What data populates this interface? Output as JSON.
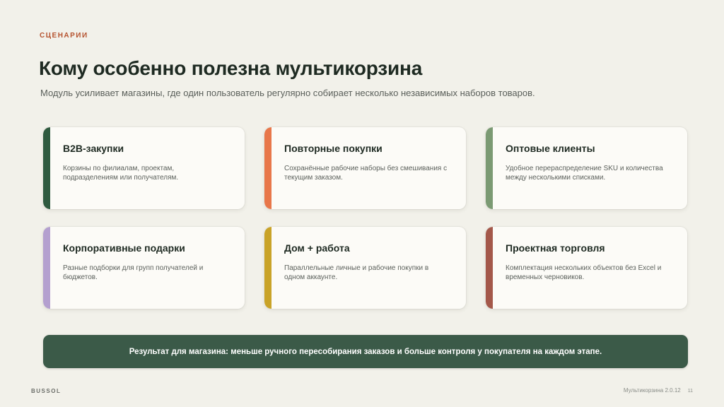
{
  "eyebrow": "СЦЕНАРИИ",
  "title": "Кому особенно полезна мультикорзина",
  "subtitle": "Модуль усиливает магазины, где один пользователь регулярно собирает несколько независимых наборов товаров.",
  "cards": [
    {
      "title": "B2B-закупки",
      "desc": "Корзины по филиалам, проектам, подразделениям или получателям.",
      "color": "#2f5a3f"
    },
    {
      "title": "Повторные покупки",
      "desc": "Сохранённые рабочие наборы без смешивания с текущим заказом.",
      "color": "#e8774a"
    },
    {
      "title": "Оптовые клиенты",
      "desc": "Удобное перераспределение SKU и количества между несколькими списками.",
      "color": "#7b9a73"
    },
    {
      "title": "Корпоративные подарки",
      "desc": "Разные подборки для групп получателей и бюджетов.",
      "color": "#b4a0cf"
    },
    {
      "title": "Дом + работа",
      "desc": "Параллельные личные и рабочие покупки в одном аккаунте.",
      "color": "#c9a328"
    },
    {
      "title": "Проектная торговля",
      "desc": "Комплектация нескольких объектов без Excel и временных черновиков.",
      "color": "#a4584a"
    }
  ],
  "result": "Результат для магазина: меньше ручного пересобирания заказов и больше контроля у покупателя на каждом этапе.",
  "footer": {
    "brand": "BUSSOL",
    "meta": "Мультикорзина 2.0.12",
    "page": "11"
  }
}
